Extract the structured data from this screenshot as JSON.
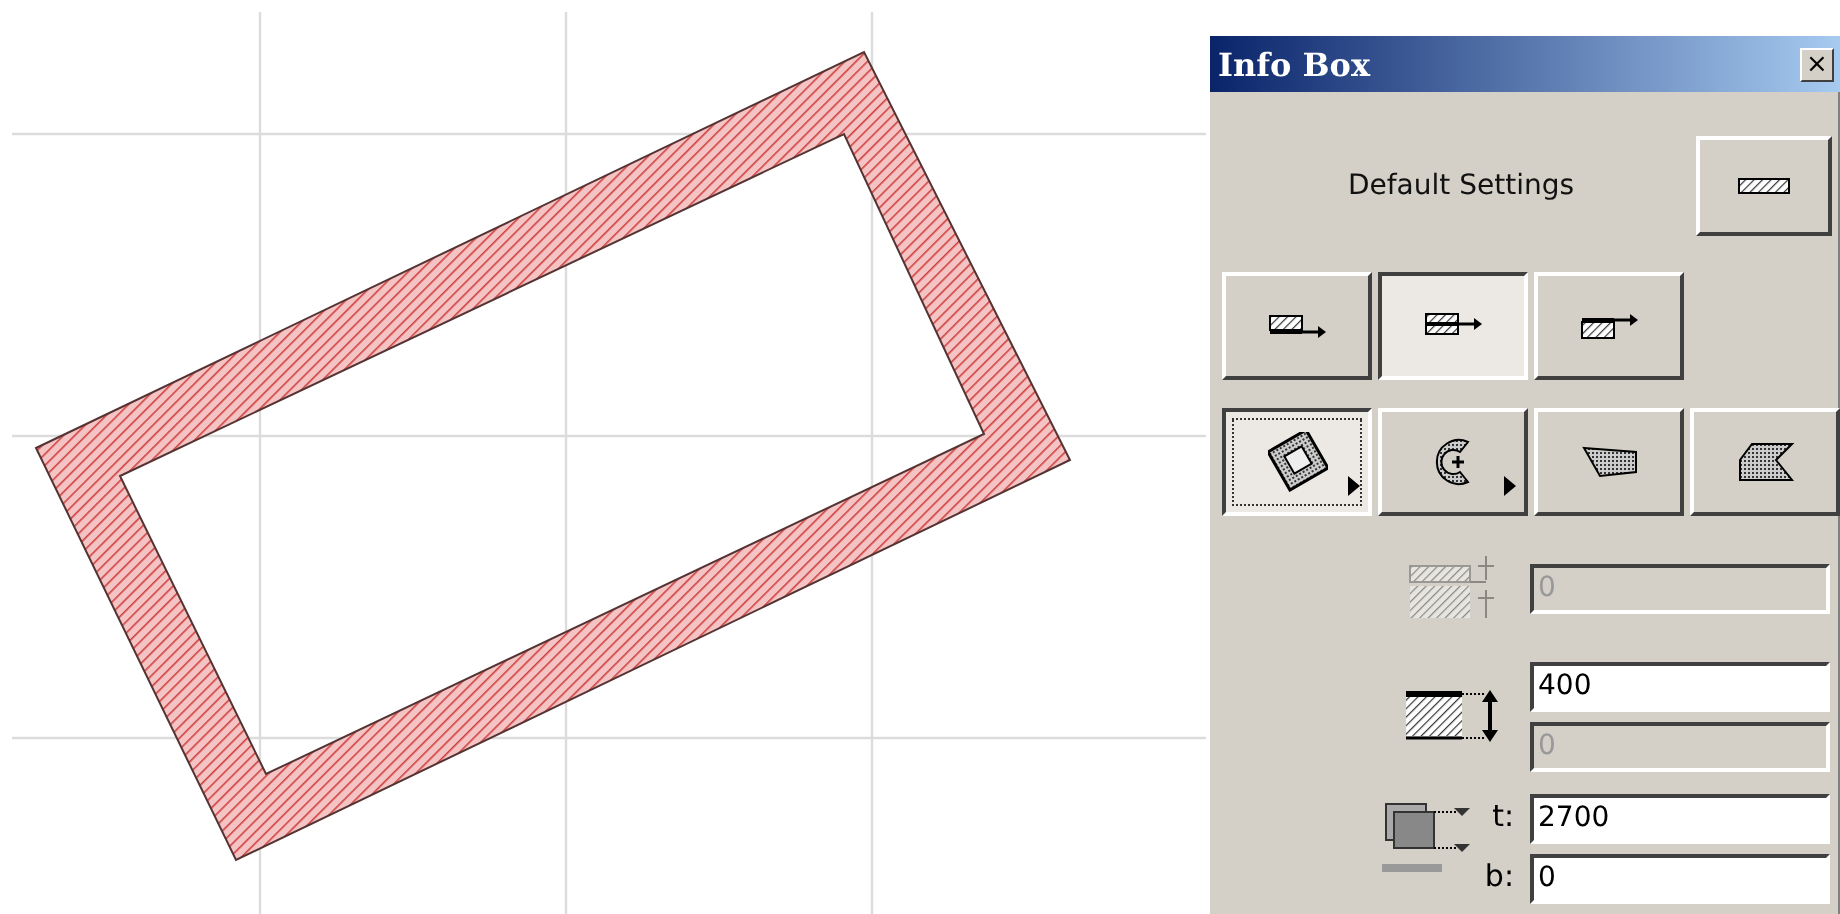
{
  "info_box": {
    "title": "Info Box",
    "close_label": "×",
    "default_label": "Default Settings",
    "reference_buttons": [
      {
        "kind": "outside",
        "selected": false
      },
      {
        "kind": "center",
        "selected": true
      },
      {
        "kind": "inside",
        "selected": false
      }
    ],
    "shape_buttons": [
      {
        "kind": "rectangular",
        "selected": true,
        "has_menu": true
      },
      {
        "kind": "curved",
        "selected": false,
        "has_menu": true
      },
      {
        "kind": "trapezoid",
        "selected": false,
        "has_menu": false
      },
      {
        "kind": "polygon",
        "selected": false,
        "has_menu": false
      }
    ],
    "rows": [
      {
        "kind": "offset",
        "fields": [
          {
            "value": "0",
            "disabled": true
          }
        ]
      },
      {
        "kind": "thickness",
        "fields": [
          {
            "value": "400",
            "disabled": false
          },
          {
            "value": "0",
            "disabled": true
          }
        ]
      },
      {
        "kind": "elevation",
        "fields": [
          {
            "label": "t:",
            "value": "2700",
            "disabled": false
          },
          {
            "label": "b:",
            "value": "0",
            "disabled": false
          }
        ]
      }
    ]
  }
}
